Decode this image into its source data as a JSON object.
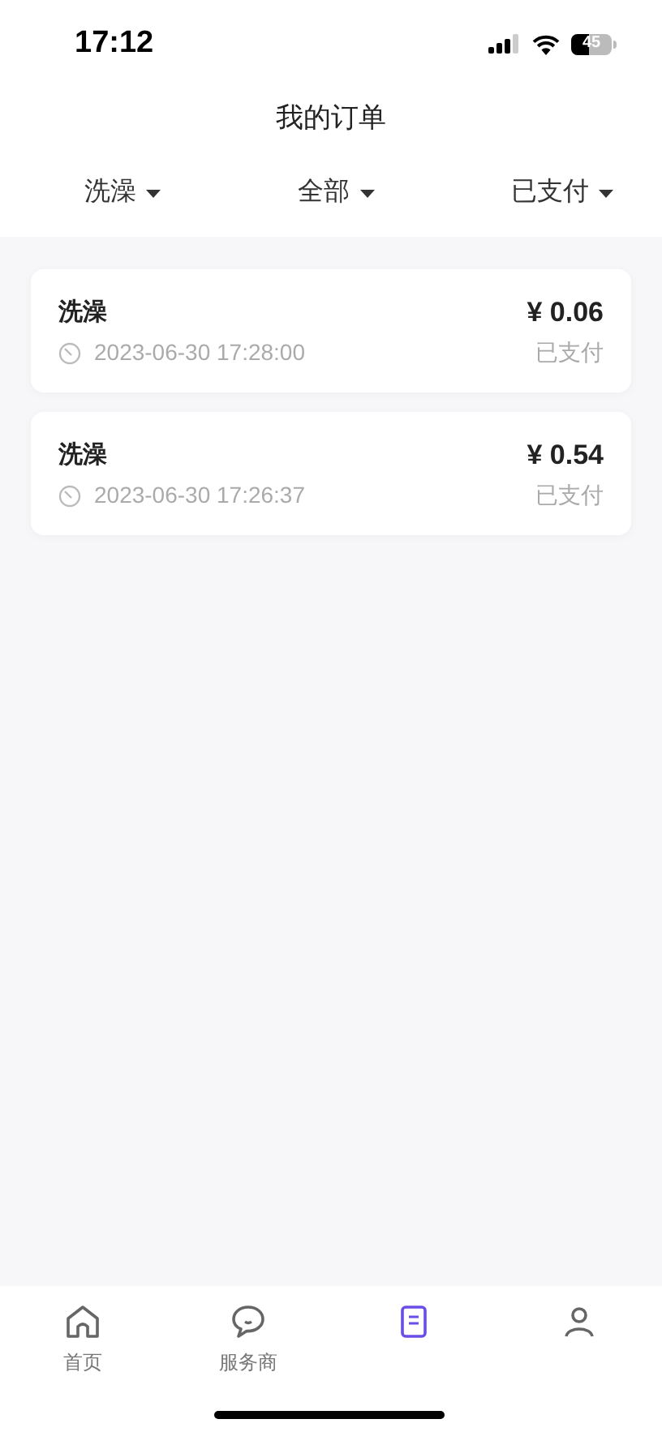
{
  "status_bar": {
    "time": "17:12",
    "battery": "45"
  },
  "header": {
    "title": "我的订单"
  },
  "filters": [
    {
      "label": "洗澡"
    },
    {
      "label": "全部"
    },
    {
      "label": "已支付"
    }
  ],
  "orders": [
    {
      "service": "洗澡",
      "time": "2023-06-30 17:28:00",
      "price": "¥ 0.06",
      "status": "已支付"
    },
    {
      "service": "洗澡",
      "time": "2023-06-30 17:26:37",
      "price": "¥ 0.54",
      "status": "已支付"
    }
  ],
  "tab_bar": [
    {
      "kind": "home",
      "label": "首页",
      "selected": false
    },
    {
      "kind": "chat",
      "label": "服务商",
      "selected": false
    },
    {
      "kind": "orders",
      "selected": true
    },
    {
      "kind": "profile",
      "selected": false
    }
  ]
}
